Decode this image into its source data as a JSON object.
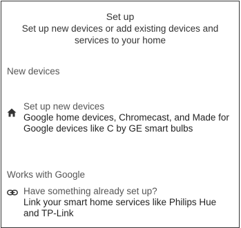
{
  "header": {
    "title": "Set up",
    "subtitle": "Set up new devices or add existing devices and services to your home"
  },
  "sections": [
    {
      "label": "New devices",
      "item": {
        "icon": "home-icon",
        "title": "Set up new devices",
        "description": "Google home devices, Chromecast, and Made for Google devices like C by GE smart bulbs"
      }
    },
    {
      "label": "Works with Google",
      "item": {
        "icon": "link-icon",
        "title": "Have something already set up?",
        "description": "Link your smart home services like Philips Hue and TP-Link"
      }
    }
  ]
}
